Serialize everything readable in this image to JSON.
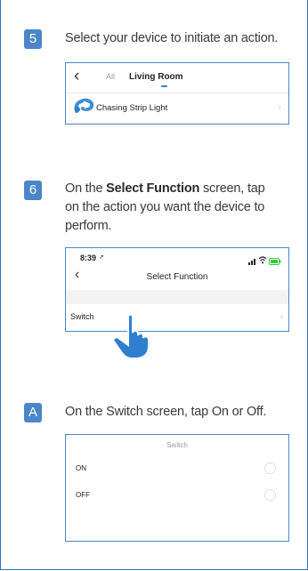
{
  "steps": [
    {
      "badge": "5",
      "text": "Select your device to initiate an action.",
      "screen": {
        "back_glyph": "‹",
        "tab_all": "All",
        "tab_room": "Living Room",
        "device_name": "Chasing Strip Light"
      }
    },
    {
      "badge": "6",
      "text_pre": "On the ",
      "text_bold": "Select Function",
      "text_post": " screen, tap on the action you want the device to perform.",
      "screen": {
        "time": "8:39",
        "back_glyph": "‹",
        "title": "Select Function",
        "row_label": "Switch"
      }
    },
    {
      "badge": "A",
      "text": "On the Switch screen, tap On or Off.",
      "screen": {
        "title": "Switch",
        "options": [
          "ON",
          "OFF"
        ]
      }
    }
  ],
  "colors": {
    "accent": "#4a86c8",
    "frame": "#2f6fbf",
    "hand": "#2f7fd1"
  },
  "icons": [
    "back-chevron-icon",
    "strip-light-icon",
    "chevron-right-icon",
    "signal-icon",
    "wifi-icon",
    "battery-icon",
    "tap-hand-icon",
    "radio-icon"
  ]
}
